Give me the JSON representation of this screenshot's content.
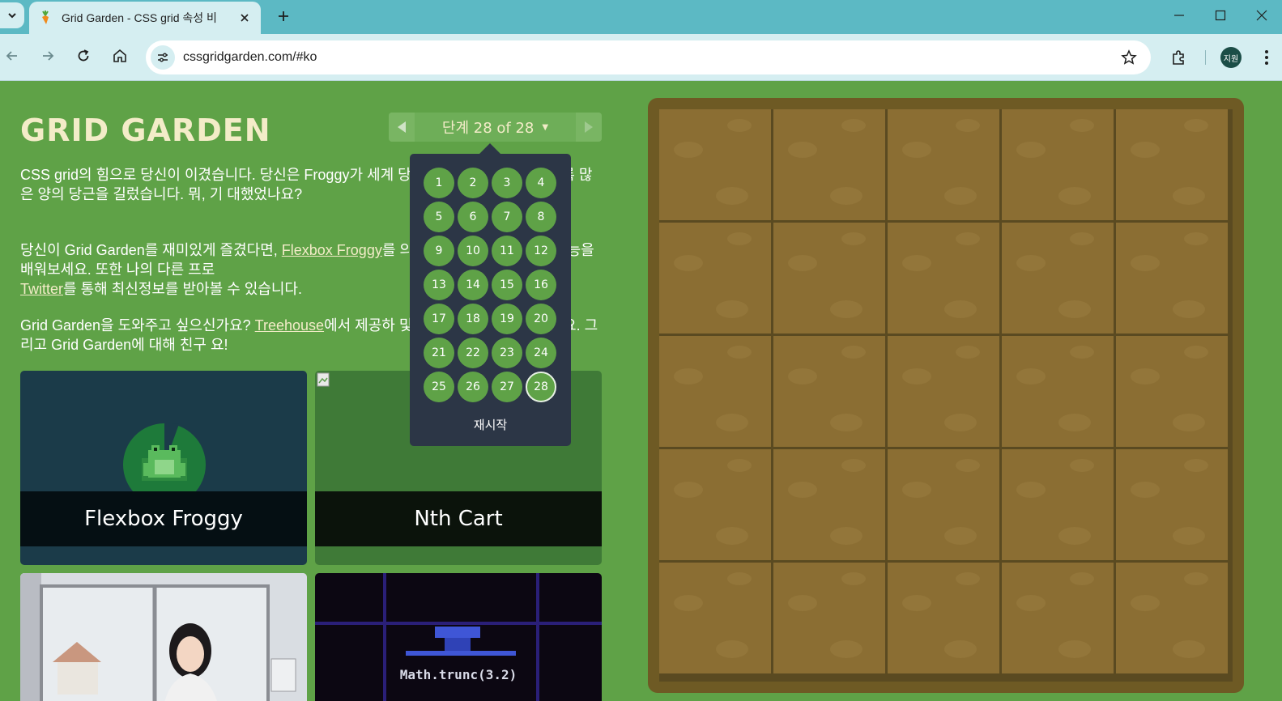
{
  "browser": {
    "tab_title": "Grid Garden - CSS grid 속성 비",
    "url": "cssgridgarden.com/#ko",
    "profile_initials": "지원",
    "chrome_color": "#5cb9c4"
  },
  "page": {
    "logo": "GRID GARDEN",
    "level_indicator": "단계 28 of 28",
    "paragraph1": {
      "text": "CSS grid의 힘으로 당신이 이겼습니다. 당신은 Froggy가 세계 당근 케이크를 만들 수 있도록 많은 양의 당근을 길렀습니다. 뭐, 기 대했었나요?"
    },
    "paragraph2": {
      "before_link1": "당신이 Grid Garden를 재미있게 즐겼다면, ",
      "link1": "Flexbox Froggy",
      "after_link1": "를 의 또 다른 강력한 새로운 기능을 배워보세요. 또한 나의 다른 프로",
      "link2": "Twitter",
      "after_link2": "를 통해 최신정보를 받아볼 수 있습니다."
    },
    "paragraph3": {
      "before_link": "Grid Garden을 도와주고 싶으신가요? ",
      "link": "Treehouse",
      "after_link": "에서 제공하 및 코딩 과정을 이용해 보세요. 그리고 Grid Garden에 대해 친구 요!"
    },
    "cards": {
      "froggy_label": "Flexbox Froggy",
      "nth_label": "Nth Cart",
      "trunc_label": "Math.trunc(3.2)"
    },
    "level_menu": {
      "levels": [
        "1",
        "2",
        "3",
        "4",
        "5",
        "6",
        "7",
        "8",
        "9",
        "10",
        "11",
        "12",
        "13",
        "14",
        "15",
        "16",
        "17",
        "18",
        "19",
        "20",
        "21",
        "22",
        "23",
        "24",
        "25",
        "26",
        "27",
        "28"
      ],
      "current_level": "28",
      "restart": "재시작"
    },
    "colors": {
      "page_green": "#5fa247",
      "menu_bg": "#2c3646",
      "soil": "#8b6e33"
    }
  }
}
